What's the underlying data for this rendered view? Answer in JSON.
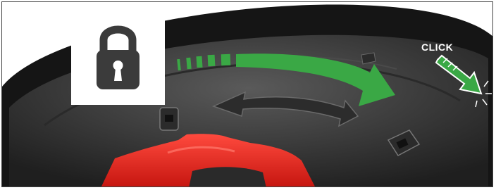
{
  "annotation": {
    "click_text": "CLICK",
    "icon": "padlock-locked-icon",
    "arrow_color": "#3aa845",
    "accent_part_color": "#e8231f"
  }
}
